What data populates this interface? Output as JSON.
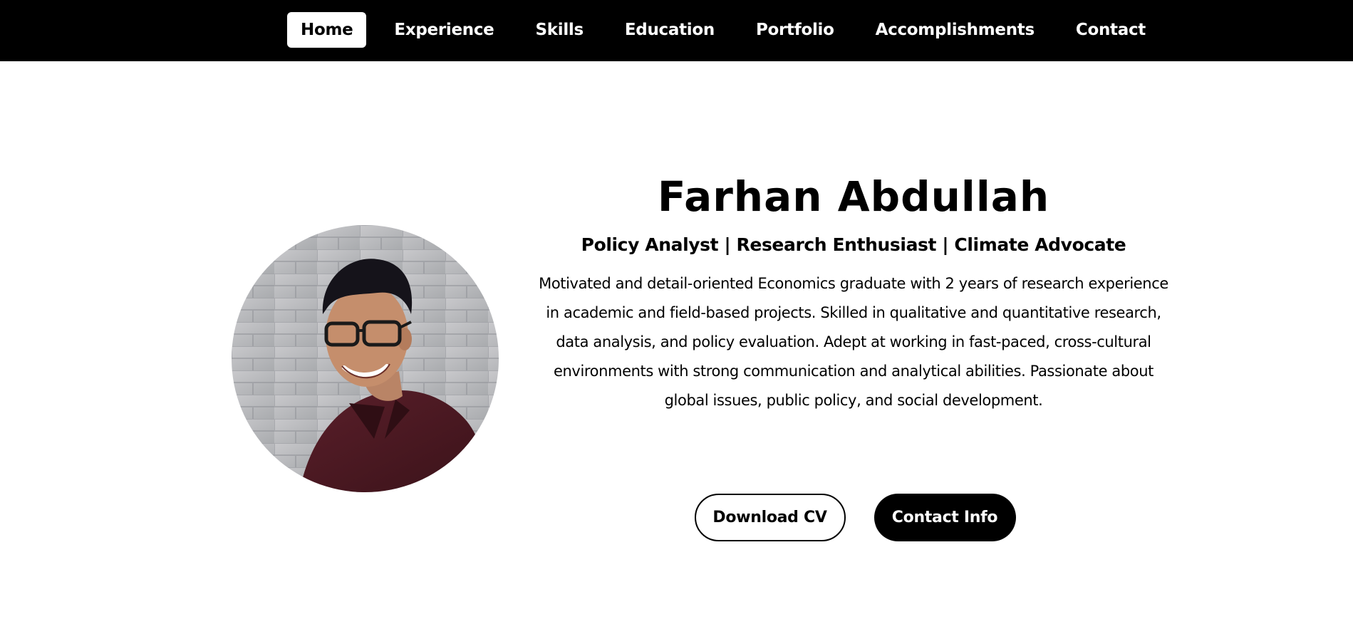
{
  "nav": {
    "items": [
      {
        "label": "Home",
        "active": true
      },
      {
        "label": "Experience"
      },
      {
        "label": "Skills"
      },
      {
        "label": "Education"
      },
      {
        "label": "Portfolio"
      },
      {
        "label": "Accomplishments"
      },
      {
        "label": "Contact"
      }
    ]
  },
  "hero": {
    "name": "Farhan Abdullah",
    "tagline": "Policy Analyst | Research Enthusiast | Climate Advocate",
    "bio": "Motivated and detail-oriented Economics graduate with 2 years of research experience in academic and field-based projects. Skilled in qualitative and quantitative research, data analysis, and policy evaluation. Adept at working in fast-paced, cross-cultural environments with strong communication and analytical abilities. Passionate about global issues, public policy, and social development.",
    "download_label": "Download CV",
    "contact_label": "Contact Info"
  },
  "colors": {
    "nav_bg": "#000000",
    "page_bg": "#ffffff",
    "accent": "#000000"
  }
}
